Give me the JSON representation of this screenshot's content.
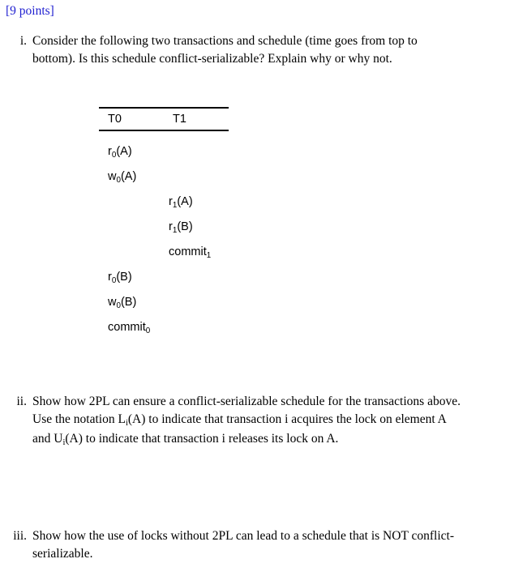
{
  "points_label": "[9 points]",
  "accent_color": "#1f1fd0",
  "text_color": "#000000",
  "background_color": "#ffffff",
  "questions": [
    {
      "marker": "i.",
      "line1": "Consider the following two transactions and schedule (time goes from top to",
      "line2": "bottom). Is this schedule conflict-serializable? Explain why or why not."
    },
    {
      "marker": "ii.",
      "line1": "Show how 2PL can ensure a conflict-serializable schedule for the transactions above.",
      "line2_a": "Use the notation L",
      "line2_sub": "i",
      "line2_b": "(A) to indicate that transaction i acquires the lock on element A",
      "line3_a": "and U",
      "line3_sub": "i",
      "line3_b": "(A) to indicate that transaction i releases its lock on A."
    },
    {
      "marker": "iii.",
      "line1": "Show how the use of locks without 2PL can lead to a schedule that is NOT conflict-",
      "line2": "serializable."
    }
  ],
  "schedule": {
    "columns": [
      "T0",
      "T1"
    ],
    "rows": [
      {
        "column": 0,
        "op": "r",
        "sub": "0",
        "arg": "(A)"
      },
      {
        "column": 0,
        "op": "w",
        "sub": "0",
        "arg": "(A)"
      },
      {
        "column": 1,
        "op": "r",
        "sub": "1",
        "arg": "(A)"
      },
      {
        "column": 1,
        "op": "r",
        "sub": "1",
        "arg": "(B)"
      },
      {
        "column": 1,
        "op": "commit",
        "sub": "1",
        "arg": ""
      },
      {
        "column": 0,
        "op": "r",
        "sub": "0",
        "arg": "(B)"
      },
      {
        "column": 0,
        "op": "w",
        "sub": "0",
        "arg": "(B)"
      },
      {
        "column": 0,
        "op": "commit",
        "sub": "0",
        "arg": ""
      }
    ]
  }
}
